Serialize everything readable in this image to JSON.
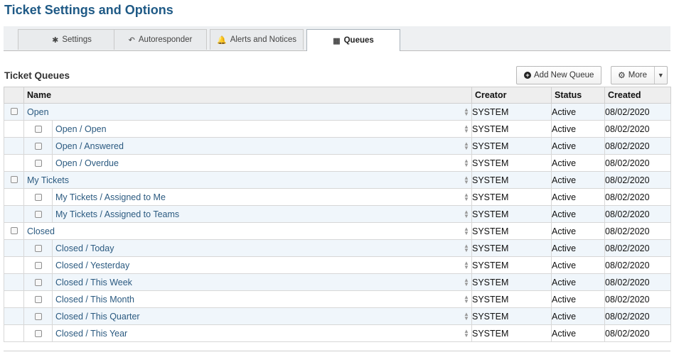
{
  "page": {
    "title": "Ticket Settings and Options"
  },
  "tabs": [
    {
      "label": "Settings",
      "icon": "asterisk-icon",
      "glyph": "✱"
    },
    {
      "label": "Autoresponder",
      "icon": "reply-icon",
      "glyph": "↶"
    },
    {
      "label": "Alerts and Notices",
      "icon": "bell-icon",
      "glyph": "🔔"
    },
    {
      "label": "Queues",
      "icon": "table-icon",
      "glyph": "▦",
      "active": true
    }
  ],
  "section": {
    "title": "Ticket Queues"
  },
  "toolbar": {
    "add_label": "Add New Queue",
    "more_label": "More"
  },
  "table": {
    "columns": [
      "Name",
      "Creator",
      "Status",
      "Created"
    ],
    "rows": [
      {
        "name": "Open",
        "level": 0,
        "creator": "SYSTEM",
        "status": "Active",
        "created": "08/02/2020"
      },
      {
        "name": "Open / Open",
        "level": 1,
        "creator": "SYSTEM",
        "status": "Active",
        "created": "08/02/2020"
      },
      {
        "name": "Open / Answered",
        "level": 1,
        "creator": "SYSTEM",
        "status": "Active",
        "created": "08/02/2020"
      },
      {
        "name": "Open / Overdue",
        "level": 1,
        "creator": "SYSTEM",
        "status": "Active",
        "created": "08/02/2020"
      },
      {
        "name": "My Tickets",
        "level": 0,
        "creator": "SYSTEM",
        "status": "Active",
        "created": "08/02/2020"
      },
      {
        "name": "My Tickets / Assigned to Me",
        "level": 1,
        "creator": "SYSTEM",
        "status": "Active",
        "created": "08/02/2020"
      },
      {
        "name": "My Tickets / Assigned to Teams",
        "level": 1,
        "creator": "SYSTEM",
        "status": "Active",
        "created": "08/02/2020"
      },
      {
        "name": "Closed",
        "level": 0,
        "creator": "SYSTEM",
        "status": "Active",
        "created": "08/02/2020"
      },
      {
        "name": "Closed / Today",
        "level": 1,
        "creator": "SYSTEM",
        "status": "Active",
        "created": "08/02/2020"
      },
      {
        "name": "Closed / Yesterday",
        "level": 1,
        "creator": "SYSTEM",
        "status": "Active",
        "created": "08/02/2020"
      },
      {
        "name": "Closed / This Week",
        "level": 1,
        "creator": "SYSTEM",
        "status": "Active",
        "created": "08/02/2020"
      },
      {
        "name": "Closed / This Month",
        "level": 1,
        "creator": "SYSTEM",
        "status": "Active",
        "created": "08/02/2020"
      },
      {
        "name": "Closed / This Quarter",
        "level": 1,
        "creator": "SYSTEM",
        "status": "Active",
        "created": "08/02/2020"
      },
      {
        "name": "Closed / This Year",
        "level": 1,
        "creator": "SYSTEM",
        "status": "Active",
        "created": "08/02/2020"
      }
    ]
  },
  "colors": {
    "title": "#1f5a86",
    "link": "#2b5a80",
    "row_shade": "#f0f6fb"
  }
}
